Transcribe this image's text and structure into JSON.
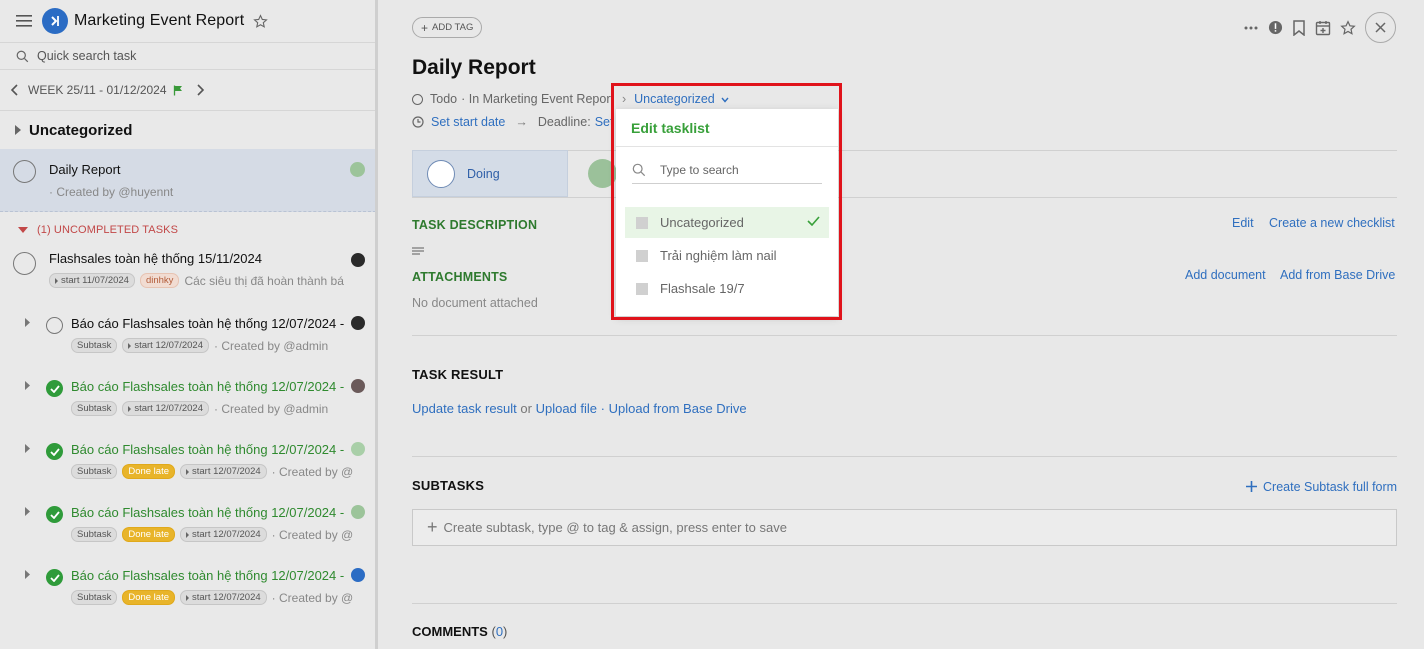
{
  "project": {
    "title": "Marketing Event Report"
  },
  "left": {
    "search_placeholder": "Quick search task",
    "week_label": "WEEK 25/11 - 01/12/2024",
    "section_title": "Uncategorized",
    "active_task": {
      "name": "Daily Report",
      "created_by": "· Created by @huyennt"
    },
    "uncompleted_label": "(1) UNCOMPLETED TASKS",
    "main_task": {
      "name": "Flashsales toàn hệ thống 15/11/2024",
      "start_tag": "start 11/07/2024",
      "user_tag": "dinhky",
      "description": "Các siêu thị đã hoàn thành bá"
    },
    "subtasks": [
      {
        "name": "Báo cáo Flashsales toàn hệ thống 12/07/2024 -",
        "done": false,
        "subtask_tag": "Subtask",
        "done_late": "",
        "start_tag": "start 12/07/2024",
        "created_by": "· Created by @admin"
      },
      {
        "name": "Báo cáo Flashsales toàn hệ thống 12/07/2024 -",
        "done": true,
        "subtask_tag": "Subtask",
        "done_late": "",
        "start_tag": "start 12/07/2024",
        "created_by": "· Created by @admin"
      },
      {
        "name": "Báo cáo Flashsales toàn hệ thống 12/07/2024 -",
        "done": true,
        "subtask_tag": "Subtask",
        "done_late": "Done late",
        "start_tag": "start 12/07/2024",
        "created_by": "· Created by @"
      },
      {
        "name": "Báo cáo Flashsales toàn hệ thống 12/07/2024 -",
        "done": true,
        "subtask_tag": "Subtask",
        "done_late": "Done late",
        "start_tag": "start 12/07/2024",
        "created_by": "· Created by @"
      },
      {
        "name": "Báo cáo Flashsales toàn hệ thống 12/07/2024 -",
        "done": true,
        "subtask_tag": "Subtask",
        "done_late": "Done late",
        "start_tag": "start 12/07/2024",
        "created_by": "· Created by @"
      }
    ]
  },
  "task": {
    "add_tag": "ADD TAG",
    "title": "Daily Report",
    "status": "Todo",
    "location": "· In Marketing Event Report",
    "breadcrumb_sep": "›",
    "tasklist": "Uncategorized",
    "set_start_date": "Set start date",
    "arrow": "→",
    "deadline_label": "Deadline:",
    "deadline_value": "Set",
    "doing_label": "Doing",
    "description_label": "TASK DESCRIPTION",
    "edit": "Edit",
    "create_checklist": "Create a new checklist",
    "attachments_label": "ATTACHMENTS",
    "add_document": "Add document",
    "add_from_drive": "Add from Base Drive",
    "no_document": "No document attached",
    "result_label": "TASK RESULT",
    "update_result": "Update task result",
    "or": "or",
    "upload_file": "Upload file",
    "dot_sep": "·",
    "upload_drive": "Upload from Base Drive",
    "subtasks_label": "SUBTASKS",
    "create_subtask_full": "Create Subtask full form",
    "subtask_placeholder": "Create subtask, type @ to tag & assign, press enter to save",
    "comments_label": "COMMENTS",
    "comments_count": "0"
  },
  "dropdown": {
    "title": "Edit tasklist",
    "search_placeholder": "Type to search",
    "items": [
      {
        "label": "Uncategorized",
        "selected": true
      },
      {
        "label": "Trải nghiệm làm nail",
        "selected": false
      },
      {
        "label": "Flashsale 19/7",
        "selected": false
      }
    ]
  },
  "colors": {
    "accent_green": "#38a03a",
    "link_blue": "#2f6fbf",
    "highlight_red": "#e0131b",
    "done_late": "#e8b42a"
  }
}
